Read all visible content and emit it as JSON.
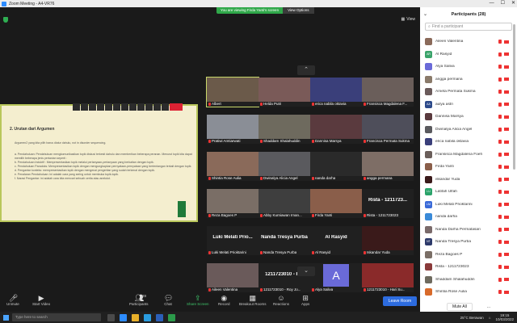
{
  "window": {
    "title": "Zoom Meeting - A4-VR76",
    "controls": [
      "—",
      "☐",
      "✕"
    ]
  },
  "banner": {
    "viewing": "You are viewing Firda Yanti's screen",
    "options": "View Options"
  },
  "view_label": "View",
  "shared_doc": {
    "heading": "2. Urutan dari Argumen",
    "intro": "Argumen2 yang kita pilih harus diatur dahulu, not in disorder sequencing.",
    "items": [
      "a. Pendahuluan: Pendahuluan mengkomunikasikan topik diskusi terkesit dahulu dan memberikan beberapa peranan. Menurut topik kita dapat memilih beberapa jenis pertanian seperti :",
      "b. Pendahuluan Induktif : Mempresentasikan topik melalui pertanyaan-pertanyaan yang berkaitan dengan topik.",
      "c. Pendahuluan Paradoks: Mempresentasikan topik dengan mengungkapkan pernyataan-pernyataan yang bertentangan terkait dengan topik.",
      "d. Pengantar konteks: mempresentasikan topik dengan mengenai pengertian yang sudah terkenal dengan topik.",
      "e. Penalaran Pendahuluan: ini adalah cara yang sering untuk membuka topik-topik.",
      "f. Narasi Pengantar: ini adalah cara kita mencari sebuah cerita atau anekdot."
    ]
  },
  "tiles": [
    {
      "name": "Albert",
      "big": "",
      "color": "#6b5a4a",
      "active": true
    },
    {
      "name": "Helda Putri",
      "big": "",
      "color": "#7a5a58"
    },
    {
      "name": "erica nabila oktavia",
      "big": "",
      "color": "#3a3f7a"
    },
    {
      "name": "Fransisca Magdalena F...",
      "big": "",
      "color": "#6a5e5a"
    },
    {
      "name": "Pratiwi Amtiarwati",
      "big": "",
      "color": "#8a8e96"
    },
    {
      "name": "Shaddam Shalahuddin",
      "big": "",
      "color": "#6e6a5e"
    },
    {
      "name": "Dannisa Marsya",
      "big": "",
      "color": "#5a3a3e"
    },
    {
      "name": "Francisca Permata Sukma",
      "big": "",
      "color": "#4e4e5a"
    },
    {
      "name": "Shintia Rose Aulia",
      "big": "",
      "color": "#8a6a5a"
    },
    {
      "name": "Dwinalya Alicia Angel",
      "big": "",
      "color": "#5a5a5e"
    },
    {
      "name": "nanda darha",
      "big": "",
      "color": "#2a2a2a"
    },
    {
      "name": "angga permana",
      "big": "",
      "color": "#7e6e66"
    },
    {
      "name": "Reza Bagoes P",
      "big": "",
      "color": "#7a6e66"
    },
    {
      "name": "Abby Kurniawan Iman...",
      "big": "",
      "color": "#3e3e3e"
    },
    {
      "name": "Firda Yanti",
      "big": "",
      "color": "#8a5e4a"
    },
    {
      "name": "Rista - 1211723023",
      "big": "Rista - 1211723...",
      "color": "#202020"
    },
    {
      "name": "Luki Melati Prioktarini",
      "big": "Luki Melati Prio...",
      "color": "#202020"
    },
    {
      "name": "Nanda Tresya Purba",
      "big": "Nanda Tresya Purba",
      "color": "#202020"
    },
    {
      "name": "Al Rasyid",
      "big": "Al Rasyid",
      "color": "#202020"
    },
    {
      "name": "Iskandar Yuda",
      "big": "",
      "color": "#3a1a1a"
    },
    {
      "name": "Aileen Valentina",
      "big": "",
      "color": "#6a5a5a"
    },
    {
      "name": "1211723010 - Roy Jo...",
      "big": "1211723010 - R...",
      "color": "#202020"
    },
    {
      "name": "Alya Saliva",
      "big": "",
      "color": "#202020",
      "avatar": "A"
    },
    {
      "name": "1211723010 - Hari Su...",
      "big": "",
      "color": "#8a2a2a"
    }
  ],
  "toolbar": {
    "unmute": "Unmute",
    "start_video": "Start Video",
    "participants": "Participants",
    "participants_count": "28",
    "chat": "Chat",
    "share": "Share Screen",
    "record": "Record",
    "breakout": "Breakout Rooms",
    "reactions": "Reactions",
    "apps": "Apps",
    "leave": "Leave Room"
  },
  "panel": {
    "title": "Participants (28)",
    "search_placeholder": "Find a participant",
    "mute_all": "Mute All",
    "more": "...",
    "participants": [
      {
        "name": "Aileen Valentina",
        "initials": "",
        "color": "#8a6a5a"
      },
      {
        "name": "Al Rasyid",
        "initials": "AR",
        "color": "#3aa36a"
      },
      {
        "name": "Alya Saliva",
        "initials": "",
        "color": "#6a6ad8"
      },
      {
        "name": "angga permana",
        "initials": "",
        "color": "#8a7a6a"
      },
      {
        "name": "Ameta Permata Sukma",
        "initials": "",
        "color": "#6a5a5a"
      },
      {
        "name": "aulya astri",
        "initials": "AA",
        "color": "#2d4a8a"
      },
      {
        "name": "Dannisa Marsya",
        "initials": "",
        "color": "#5a3a3e"
      },
      {
        "name": "Dwinalya Alicia Angel",
        "initials": "",
        "color": "#5a5a5e"
      },
      {
        "name": "erica nabila oktavia",
        "initials": "",
        "color": "#3a3f7a"
      },
      {
        "name": "Fransisca Magdalena Foeh",
        "initials": "",
        "color": "#6a5e5a"
      },
      {
        "name": "Firda Yanti",
        "initials": "",
        "color": "#8a5e4a"
      },
      {
        "name": "iskandar Yuda",
        "initials": "",
        "color": "#3a1a1a"
      },
      {
        "name": "Latifah Ulfah",
        "initials": "LU",
        "color": "#2aa36a"
      },
      {
        "name": "Luki Melati Prioktarini",
        "initials": "LM",
        "color": "#3a6ad8"
      },
      {
        "name": "nanda darha",
        "initials": "",
        "color": "#3a8ad8"
      },
      {
        "name": "Nanda Darha Permatasari",
        "initials": "",
        "color": "#7a6a6a"
      },
      {
        "name": "Nanda Tresya Purba",
        "initials": "NT",
        "color": "#2d3a6a"
      },
      {
        "name": "Reza Bagoes P",
        "initials": "",
        "color": "#7a6e66"
      },
      {
        "name": "Rista - 1211723023",
        "initials": "",
        "color": "#8a3a3a"
      },
      {
        "name": "Shaddam Shalahuddin",
        "initials": "",
        "color": "#6e6a5e"
      },
      {
        "name": "Shintia Rose Aulia",
        "initials": "",
        "color": "#d86a2a"
      }
    ]
  },
  "taskbar": {
    "search": "Type here to search",
    "weather": "25°C  Berawan",
    "time": "19:15",
    "date": "10/03/2022"
  }
}
